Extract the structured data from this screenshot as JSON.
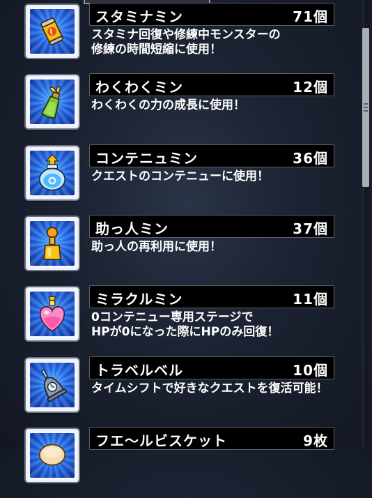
{
  "items": [
    {
      "name": "スタミナミン",
      "count": "71個",
      "desc": [
        "スタミナ回復や修練中モンスターの",
        "修練の時間短縮に使用！"
      ],
      "icon": "stamina-can-icon"
    },
    {
      "name": "わくわくミン",
      "count": "12個",
      "desc": [
        "わくわくの力の成長に使用！"
      ],
      "icon": "sprout-bottle-icon"
    },
    {
      "name": "コンテニュミン",
      "count": "36個",
      "desc": [
        "クエストのコンテニューに使用！"
      ],
      "icon": "continue-jar-icon"
    },
    {
      "name": "助っ人ミン",
      "count": "37個",
      "desc": [
        "助っ人の再利用に使用！"
      ],
      "icon": "helper-bottle-icon"
    },
    {
      "name": "ミラクルミン",
      "count": "11個",
      "desc": [
        "0コンテニュー専用ステージで",
        "HPが0になった際にHPのみ回復！"
      ],
      "icon": "heart-potion-icon"
    },
    {
      "name": "トラベルベル",
      "count": "10個",
      "desc": [
        "タイムシフトで好きなクエストを復活可能！"
      ],
      "icon": "bell-icon"
    },
    {
      "name": "フエ〜ルビスケット",
      "count": "9枚",
      "desc": [],
      "icon": "biscuit-icon"
    }
  ],
  "colors": {
    "panel_bg": "#1b2231",
    "icon_bg": "#1c64e0",
    "name_bar": "#000000",
    "text": "#ffffff"
  }
}
